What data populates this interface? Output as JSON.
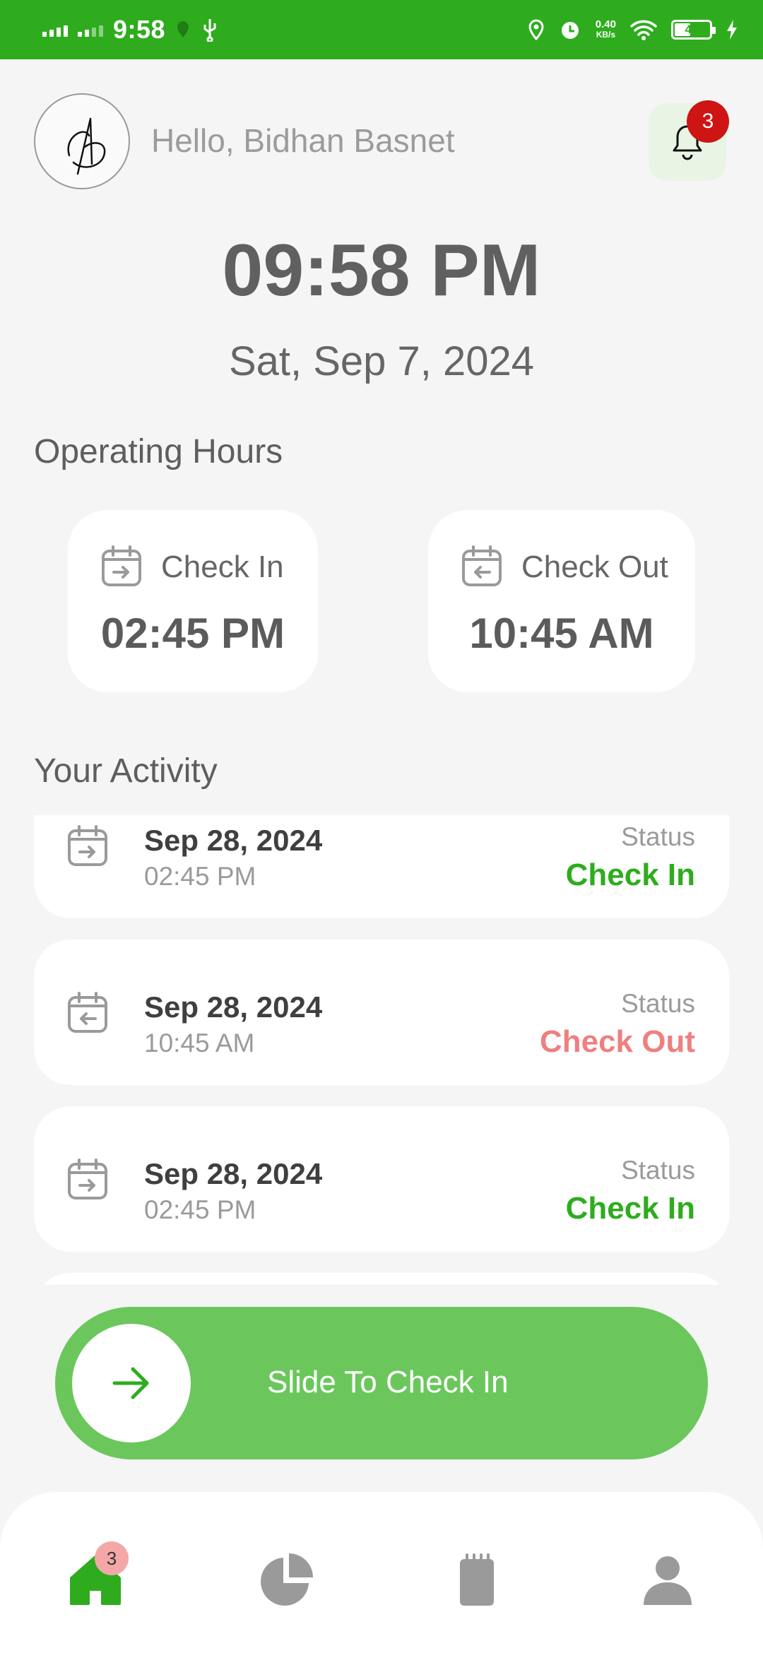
{
  "status_bar": {
    "time": "9:58",
    "net_speed_value": "0.40",
    "net_speed_unit": "KB/s",
    "battery": "42",
    "battery_level": 0.42
  },
  "header": {
    "greeting": "Hello, Bidhan Basnet",
    "notification_count": "3"
  },
  "clock": {
    "time": "09:58 PM",
    "date": "Sat, Sep 7, 2024"
  },
  "operating_hours": {
    "title": "Operating Hours",
    "check_in_label": "Check In",
    "check_in_time": "02:45 PM",
    "check_out_label": "Check Out",
    "check_out_time": "10:45 AM"
  },
  "activity": {
    "title": "Your Activity",
    "items": [
      {
        "date": "Sep 28, 2024",
        "time": "02:45 PM",
        "status_label": "Status",
        "status": "Check In",
        "type": "in"
      },
      {
        "date": "Sep 28, 2024",
        "time": "10:45 AM",
        "status_label": "Status",
        "status": "Check Out",
        "type": "out"
      },
      {
        "date": "Sep 28, 2024",
        "time": "02:45 PM",
        "status_label": "Status",
        "status": "Check In",
        "type": "in"
      }
    ]
  },
  "slider": {
    "label": "Slide To Check In"
  },
  "bottom_nav": {
    "items": [
      {
        "icon": "home-icon",
        "active": true,
        "badge": "3"
      },
      {
        "icon": "pie-chart-icon",
        "active": false
      },
      {
        "icon": "notepad-icon",
        "active": false
      },
      {
        "icon": "profile-icon",
        "active": false
      }
    ]
  },
  "colors": {
    "accent": "#2eac1e",
    "slider": "#6bc75c",
    "check_out": "#ee8080",
    "badge": "#cf1414"
  }
}
